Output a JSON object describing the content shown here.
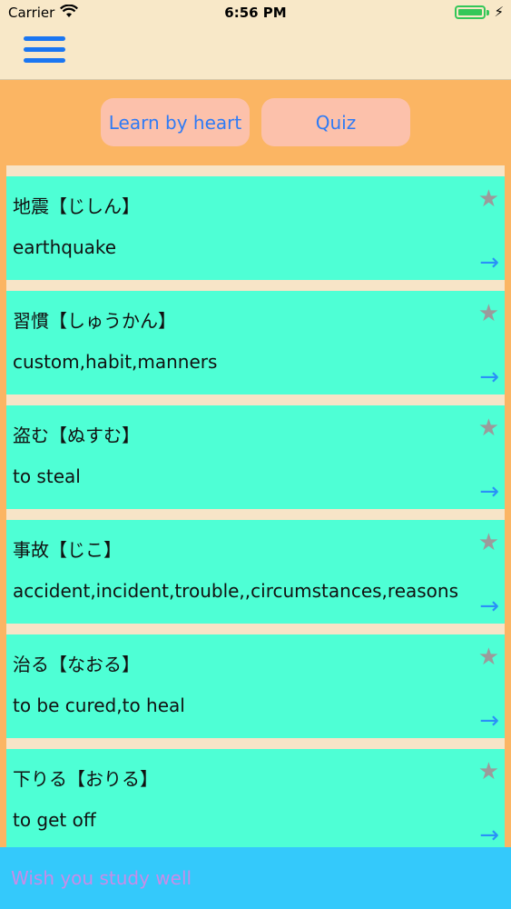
{
  "status_bar": {
    "carrier": "Carrier",
    "time": "6:56 PM"
  },
  "nav": {
    "menu_icon": "hamburger-menu-icon"
  },
  "buttons": {
    "learn": "Learn by heart",
    "quiz": "Quiz"
  },
  "cards": [
    {
      "word": "地震【じしん】",
      "meaning": "earthquake"
    },
    {
      "word": "習慣【しゅうかん】",
      "meaning": "custom,habit,manners"
    },
    {
      "word": "盗む【ぬすむ】",
      "meaning": "to steal"
    },
    {
      "word": "事故【じこ】",
      "meaning": "accident,incident,trouble,,circumstances,reasons"
    },
    {
      "word": "治る【なおる】",
      "meaning": "to be cured,to heal"
    },
    {
      "word": "下りる【おりる】",
      "meaning": "to get off"
    }
  ],
  "icons": {
    "star": "★",
    "arrow": "→"
  },
  "banner": {
    "text": "Wish you study well"
  },
  "colors": {
    "background": "#fbb563",
    "card": "#4effd5",
    "button": "#fcc1ab",
    "accent": "#2f7bf5",
    "banner": "#34c9fb"
  }
}
